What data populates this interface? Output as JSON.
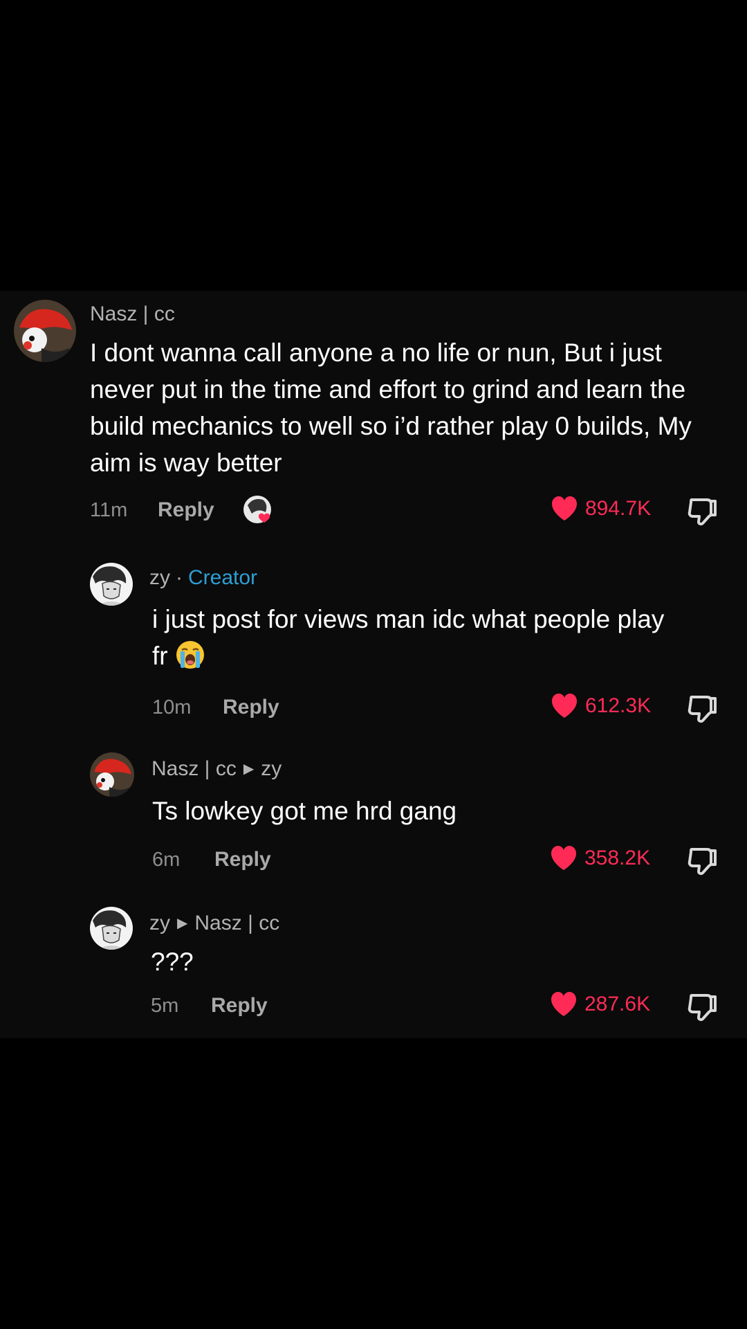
{
  "colors": {
    "like": "#ff2b56",
    "creator": "#2e9fd4",
    "background": "#000000",
    "panel": "#0b0b0b"
  },
  "comments": [
    {
      "username": "Nasz | cc",
      "text": "I dont wanna call anyone a no life or nun, But i just never put in the time and effort to grind and learn the build mechanics to well so i’d rather play 0 builds, My aim is way better",
      "time": "11m",
      "reply_label": "Reply",
      "likes": "894.7K",
      "creator_liked": true
    },
    {
      "username": "zy",
      "badge": "Creator",
      "text": "i just post for views man idc what people play fr",
      "emoji": "loudly-crying-face",
      "time": "10m",
      "reply_label": "Reply",
      "likes": "612.3K"
    },
    {
      "username": "Nasz | cc",
      "reply_to": "zy",
      "text": "Ts lowkey got me hrd gang",
      "time": "6m",
      "reply_label": "Reply",
      "likes": "358.2K"
    },
    {
      "username": "zy",
      "reply_to": "Nasz | cc",
      "text": "???",
      "time": "5m",
      "reply_label": "Reply",
      "likes": "287.6K"
    }
  ]
}
